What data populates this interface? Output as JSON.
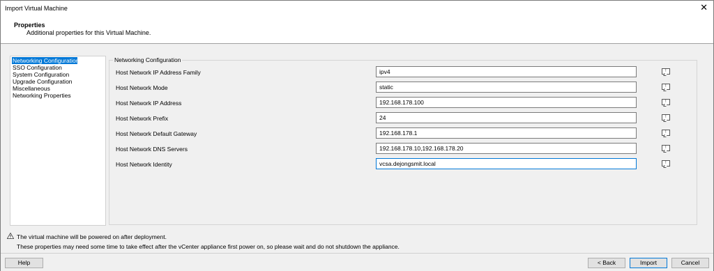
{
  "window": {
    "title": "Import Virtual Machine",
    "close_glyph": "✕"
  },
  "header": {
    "title": "Properties",
    "subtitle": "Additional properties for this Virtual Machine."
  },
  "nav": {
    "items": [
      {
        "label": "Networking Configuration",
        "selected": true
      },
      {
        "label": "SSO Configuration",
        "selected": false
      },
      {
        "label": "System Configuration",
        "selected": false
      },
      {
        "label": "Upgrade Configuration",
        "selected": false
      },
      {
        "label": "Miscellaneous",
        "selected": false
      },
      {
        "label": "Networking Properties",
        "selected": false
      }
    ]
  },
  "panel": {
    "group_title": "Networking Configuration",
    "rows": [
      {
        "label": "Host Network IP Address Family",
        "value": "ipv4"
      },
      {
        "label": "Host Network Mode",
        "value": "static"
      },
      {
        "label": "Host Network IP Address",
        "value": "192.168.178.100"
      },
      {
        "label": "Host Network Prefix",
        "value": "24"
      },
      {
        "label": "Host Network Default Gateway",
        "value": "192.168.178.1"
      },
      {
        "label": "Host Network DNS Servers",
        "value": "192.168.178.10,192.168.178.20"
      },
      {
        "label": "Host Network Identity",
        "value": "vcsa.dejongsmit.local"
      }
    ],
    "row_icon": "comment-icon"
  },
  "notice": {
    "warning": "The virtual machine will be powered on after deployment.",
    "info": "These properties may need some time to take effect after the vCenter appliance first power on, so please wait and do not shutdown the appliance."
  },
  "footer": {
    "help_label": "Help",
    "back_label": "< Back",
    "import_label": "Import",
    "cancel_label": "Cancel"
  },
  "colors": {
    "selection": "#0078d7",
    "window_bg": "#f0f0f0",
    "warning": "#e8b500"
  }
}
